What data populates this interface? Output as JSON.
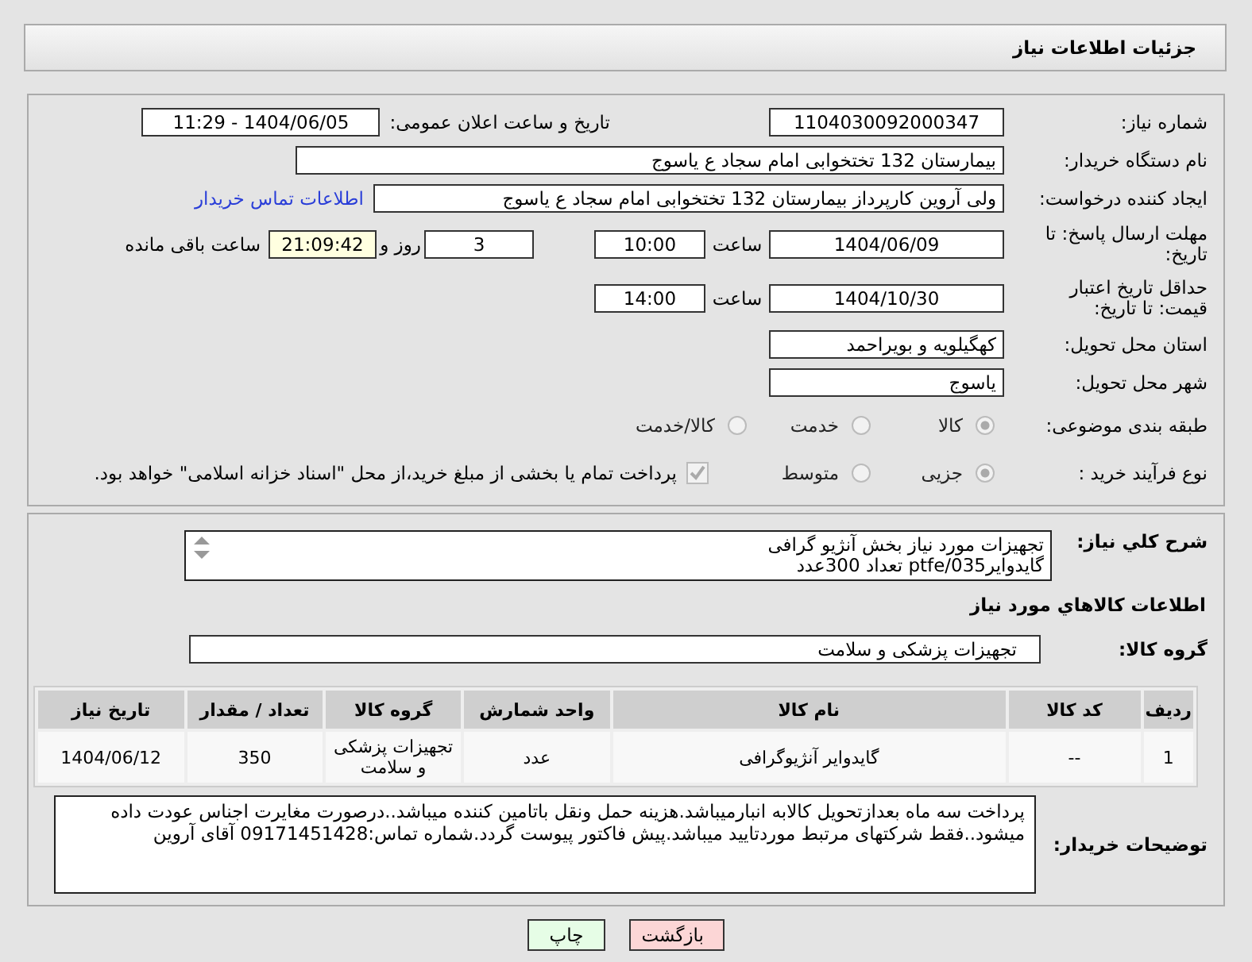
{
  "header": {
    "title": "جزئیات اطلاعات نیاز"
  },
  "need_number": {
    "label": "شماره نیاز:",
    "value": "1104030092000347"
  },
  "announce": {
    "label": "تاریخ و ساعت اعلان عمومی:",
    "value": "1404/06/05 - 11:29"
  },
  "buyer_org": {
    "label": "نام دستگاه خریدار:",
    "value": "بیمارستان 132 تختخوابی امام سجاد  ع  یاسوج"
  },
  "requester": {
    "label": "ایجاد کننده درخواست:",
    "value": "ولی آروین کارپرداز بیمارستان 132 تختخوابی امام سجاد  ع  یاسوج",
    "link": "اطلاعات تماس خریدار"
  },
  "deadline": {
    "label": "مهلت ارسال پاسخ: تا تاریخ:",
    "date": "1404/06/09",
    "time_label": "ساعت",
    "time": "10:00",
    "days": "3",
    "days_label": "روز و",
    "remaining": "21:09:42",
    "remaining_label": "ساعت باقی مانده"
  },
  "validity": {
    "label": "حداقل تاریخ اعتبار قیمت: تا تاریخ:",
    "date": "1404/10/30",
    "time_label": "ساعت",
    "time": "14:00"
  },
  "province": {
    "label": "استان محل تحویل:",
    "value": "کهگیلویه و بویراحمد"
  },
  "city": {
    "label": "شهر محل تحویل:",
    "value": "یاسوج"
  },
  "category": {
    "label": "طبقه بندی موضوعی:",
    "options": [
      {
        "label": "کالا",
        "selected": true
      },
      {
        "label": "خدمت",
        "selected": false
      },
      {
        "label": "کالا/خدمت",
        "selected": false
      }
    ]
  },
  "process": {
    "label": "نوع فرآیند خرید :",
    "options": [
      {
        "label": "جزیی",
        "selected": true
      },
      {
        "label": "متوسط",
        "selected": false
      }
    ],
    "payment": {
      "label": "پرداخت تمام یا بخشی از مبلغ خرید،از محل \"اسناد خزانه اسلامی\" خواهد بود.",
      "checked": true
    }
  },
  "description": {
    "label": "شرح کلي نياز:",
    "lines": [
      "تجهیزات مورد نیاز بخش آنژیو گرافی",
      "گایدوایرptfe/035 تعداد 300عدد"
    ]
  },
  "goods_title": "اطلاعات كالاهاي مورد نياز",
  "goods_group": {
    "label": "گروه کالا:",
    "value": "تجهیزات پزشکی و سلامت"
  },
  "table": {
    "columns": [
      "ردیف",
      "کد کالا",
      "نام کالا",
      "واحد شمارش",
      "گروه کالا",
      "تعداد / مقدار",
      "تاریخ نیاز"
    ],
    "rows": [
      [
        "1",
        "--",
        "گایدوایر آنژیوگرافی",
        "عدد",
        "تجهیزات پزشکی و سلامت",
        "350",
        "1404/06/12"
      ]
    ]
  },
  "notes": {
    "label": "توضیحات خریدار:",
    "value": "پرداخت سه ماه بعدازتحویل کالابه انبارمیباشد.هزینه حمل ونقل باتامین کننده میباشد..درصورت مغایرت اجناس عودت داده میشود..فقط شرکتهای مرتبط موردتایید میباشد.پیش فاکتور پیوست گردد.شماره تماس:09171451428 آقای آروین"
  },
  "buttons": [
    {
      "label": "بازگشت",
      "kind": "back"
    },
    {
      "label": "چاپ",
      "kind": "print"
    }
  ]
}
